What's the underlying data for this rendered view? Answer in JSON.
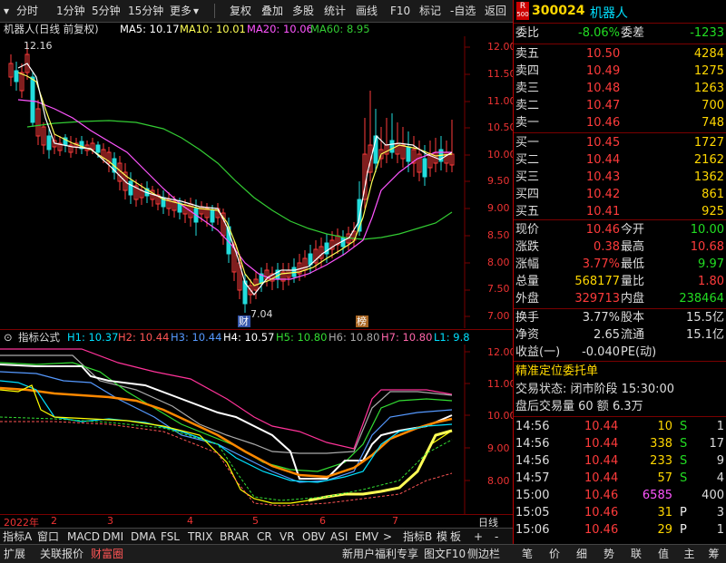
{
  "toolbar": {
    "items": [
      "分时",
      "1分钟",
      "5分钟",
      "15分钟",
      "更多",
      "复权",
      "叠加",
      "多股",
      "统计",
      "画线",
      "F10",
      "标记",
      "-自选",
      "返回"
    ]
  },
  "main_legend": {
    "name": "机器人(日线 前复权)",
    "ma5": "MA5: 10.17",
    "ma10": "MA10: 10.01",
    "ma20": "MA20: 10.06",
    "ma60": "MA60: 8.95"
  },
  "main_chart": {
    "high_label": "12.16",
    "low_label": "7.04",
    "cai_badge": "财",
    "bang_badge": "榜",
    "y_ticks": [
      "12.00",
      "11.50",
      "11.00",
      "10.50",
      "10.00",
      "9.50",
      "9.00",
      "8.50",
      "8.00",
      "7.50",
      "7.00"
    ]
  },
  "sub_legend": {
    "name": "指标公式",
    "h1": "H1: 10.37",
    "h2": "H2: 10.44",
    "h3": "H3: 10.44",
    "h4": "H4: 10.57",
    "h5": "H5: 10.80",
    "h6": "H6: 10.80",
    "h7": "H7: 10.80",
    "l1": "L1: 9.8"
  },
  "sub_chart": {
    "y_ticks": [
      "12.00",
      "11.00",
      "10.00",
      "9.00",
      "8.00"
    ]
  },
  "date_axis": {
    "labels": [
      "2022年",
      "2",
      "3",
      "4",
      "5",
      "6",
      "7"
    ],
    "right_label": "日线"
  },
  "bottom_tabs": {
    "items": [
      "指标A",
      "窗口",
      "MACD",
      "DMI",
      "DMA",
      "FSL",
      "TRIX",
      "BRAR",
      "CR",
      "VR",
      "OBV",
      "ASI",
      "EMV",
      ">",
      "指标B",
      "模",
      "板",
      "+",
      "-"
    ]
  },
  "status_bar": {
    "left": [
      "扩展",
      "关联报价",
      "财富圈"
    ],
    "mid": [
      "新用户福利专享",
      "图文F10",
      "侧边栏"
    ],
    "right": [
      "笔",
      "价",
      "细",
      "势",
      "联",
      "值",
      "主",
      "筹"
    ]
  },
  "quote": {
    "r_badge": "R",
    "r_num": "500",
    "code": "300024",
    "name": "机器人",
    "wei_bi_label": "委比",
    "wei_bi": "-8.06%",
    "wei_cha_label": "委差",
    "wei_cha": "-1233",
    "sell": [
      {
        "label": "卖五",
        "price": "10.50",
        "vol": "4284"
      },
      {
        "label": "卖四",
        "price": "10.49",
        "vol": "1275"
      },
      {
        "label": "卖三",
        "price": "10.48",
        "vol": "1263"
      },
      {
        "label": "卖二",
        "price": "10.47",
        "vol": "700"
      },
      {
        "label": "卖一",
        "price": "10.46",
        "vol": "748"
      }
    ],
    "buy": [
      {
        "label": "买一",
        "price": "10.45",
        "vol": "1727"
      },
      {
        "label": "买二",
        "price": "10.44",
        "vol": "2162"
      },
      {
        "label": "买三",
        "price": "10.43",
        "vol": "1362"
      },
      {
        "label": "买四",
        "price": "10.42",
        "vol": "861"
      },
      {
        "label": "买五",
        "price": "10.41",
        "vol": "925"
      }
    ],
    "stats": [
      {
        "l1": "现价",
        "v1": "10.46",
        "c1": "red",
        "l2": "今开",
        "v2": "10.00",
        "c2": "green"
      },
      {
        "l1": "涨跌",
        "v1": "0.38",
        "c1": "red",
        "l2": "最高",
        "v2": "10.68",
        "c2": "red"
      },
      {
        "l1": "涨幅",
        "v1": "3.77%",
        "c1": "red",
        "l2": "最低",
        "v2": "9.97",
        "c2": "green"
      },
      {
        "l1": "总量",
        "v1": "568177",
        "c1": "yellow",
        "l2": "量比",
        "v2": "1.80",
        "c2": "red"
      },
      {
        "l1": "外盘",
        "v1": "329713",
        "c1": "red",
        "l2": "内盘",
        "v2": "238464",
        "c2": "green"
      }
    ],
    "stats2": [
      {
        "l1": "换手",
        "v1": "3.77%",
        "l2": "股本",
        "v2": "15.5亿"
      },
      {
        "l1": "净资",
        "v1": "2.65",
        "l2": "流通",
        "v2": "15.1亿"
      },
      {
        "l1": "收益(一)",
        "v1": "-0.040",
        "l2": "PE(动)",
        "v2": ""
      }
    ],
    "precise_title": "精准定位委托单",
    "trade_status": "交易状态: 闭市阶段 15:30:00",
    "after_hours": "盘后交易量 60 额 6.3万",
    "ticks": [
      {
        "time": "14:56",
        "price": "10.44",
        "vol": "10",
        "bs": "S",
        "n": "1",
        "vc": "yellow"
      },
      {
        "time": "14:56",
        "price": "10.44",
        "vol": "338",
        "bs": "S",
        "n": "17",
        "vc": "yellow"
      },
      {
        "time": "14:56",
        "price": "10.44",
        "vol": "233",
        "bs": "S",
        "n": "9",
        "vc": "yellow"
      },
      {
        "time": "14:57",
        "price": "10.44",
        "vol": "57",
        "bs": "S",
        "n": "4",
        "vc": "yellow"
      },
      {
        "time": "15:00",
        "price": "10.46",
        "vol": "6585",
        "bs": "",
        "n": "400",
        "vc": "magenta"
      },
      {
        "time": "15:05",
        "price": "10.46",
        "vol": "31",
        "bs": "P",
        "n": "3",
        "vc": "yellow"
      },
      {
        "time": "15:06",
        "price": "10.46",
        "vol": "29",
        "bs": "P",
        "n": "1",
        "vc": "yellow"
      }
    ]
  },
  "colors": {
    "up": "#ff3b3b",
    "down": "#22dd22",
    "ma5": "#ffffff",
    "ma10": "#ffff55",
    "ma20": "#ff55ff",
    "ma60": "#33cc33",
    "accent_border": "#b00000"
  }
}
